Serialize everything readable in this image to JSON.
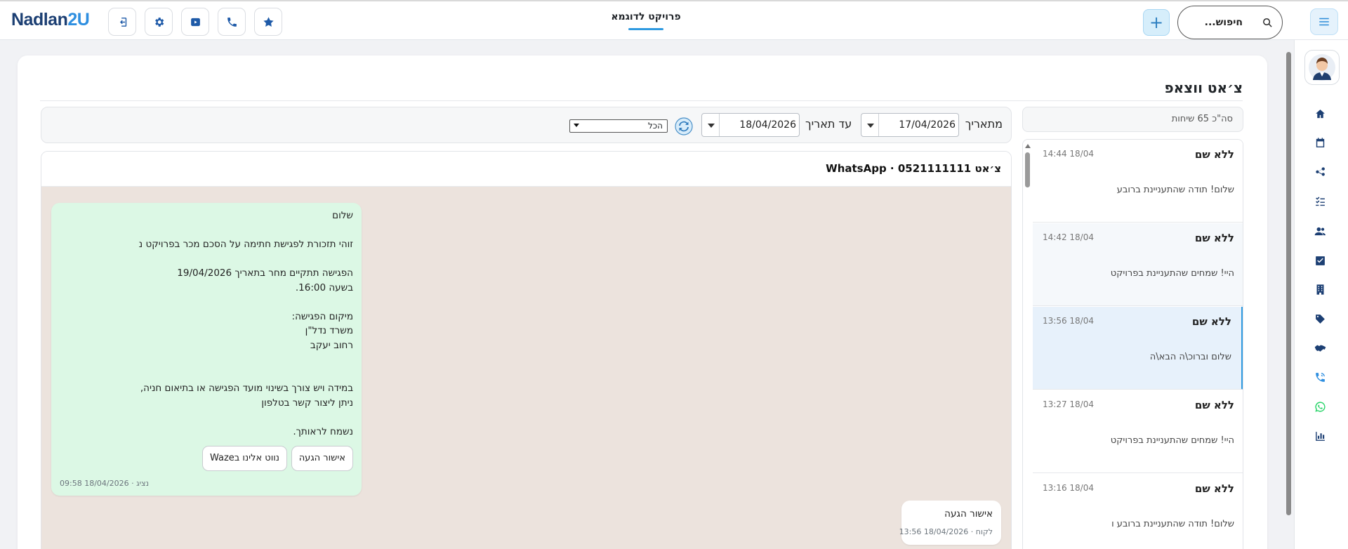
{
  "header": {
    "logo_main": "Nadlan",
    "logo_accent": "2U",
    "project_title": "פרויקט לדוגמא",
    "search_placeholder": "חיפוש...",
    "add_label": "+"
  },
  "page": {
    "heading": "צ׳אט ווצאפ",
    "total_chats": "סה\"כ 65 שיחות"
  },
  "filters": {
    "from_label": "מתאריך",
    "from_value": "17/04/2026",
    "to_label": "עד תאריך",
    "to_value": "18/04/2026",
    "select_value": "הכל"
  },
  "chat_list": [
    {
      "name": "ללא שם",
      "time": "14:44 18/04",
      "message": "שלום! תודה שהתעניינת ברובע"
    },
    {
      "name": "ללא שם",
      "time": "14:42 18/04",
      "message": "היי! שמחים שהתעניינת בפרויקט"
    },
    {
      "name": "ללא שם",
      "time": "13:56 18/04",
      "message": "שלום וברוכ\\ה הבא\\ה"
    },
    {
      "name": "ללא שם",
      "time": "13:27 18/04",
      "message": "היי! שמחים שהתעניינת בפרויקט"
    },
    {
      "name": "ללא שם",
      "time": "13:16 18/04",
      "message": "שלום! תודה שהתעניינת ברובע ו"
    }
  ],
  "conversation": {
    "title": "צ׳אט  0521111111 · WhatsApp",
    "outgoing": {
      "text": "שלום\n\nזוהי תזכורת לפגישת חתימה על הסכם מכר בפרויקט נ\n\nהפגישה תתקיים מחר בתאריך 19/04/2026\nבשעה 16:00.\n\nמיקום הפגישה:\nמשרד נדל\"ן\nרחוב יעקב\n\n\nבמידה ויש צורך בשינוי מועד הפגישה או בתיאום חניה,\nניתן ליצור קשר בטלפון\n\nנשמח לראותך.",
      "button_confirm": "אישור הגעה",
      "button_waze": "נווט אלינו בWaze",
      "meta": "נציג · 18/04/2026 09:58"
    },
    "incoming": {
      "text": "אישור הגעה",
      "meta": "לקוח · 18/04/2026 13:56"
    }
  }
}
